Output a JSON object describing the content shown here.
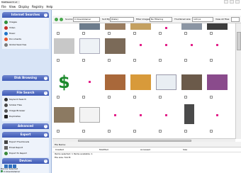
{
  "window": {
    "title": "MultiSearch v1"
  },
  "menu": [
    "File",
    "View",
    "Display",
    "Registry",
    "Help"
  ],
  "toolbar": {
    "source_label": "Source",
    "source_value": "C:\\Users\\Owner",
    "sort_label": "Sort By",
    "sort_value": "[Date]",
    "mode_label": "Filter images",
    "mode_value": "No Filtering",
    "size_label": "Thumbnail size",
    "size_value": "120 px",
    "view_label": "View All Files"
  },
  "sidebar": {
    "sections": [
      {
        "title": "Internet Searches",
        "items": [
          "Images",
          "Video",
          "Music",
          "Documents",
          "Global Searches"
        ]
      },
      {
        "title": "Disk Browsing",
        "items": []
      },
      {
        "title": "File Search",
        "items": [
          "Keyword Search",
          "Similar Files",
          "Image Browser",
          "Duplicates"
        ]
      },
      {
        "title": "Advanced",
        "items": []
      },
      {
        "title": "Export",
        "items": [
          "Export Thumbnails",
          "Email Report",
          "Export To Report"
        ]
      },
      {
        "title": "Devices",
        "items": []
      }
    ],
    "device_label": "Device Selected",
    "device_value": "C:\\Users\\Owner"
  },
  "file_info": {
    "header": "File Name:"
  },
  "columns": [
    "Created",
    "Modified",
    "Accessed",
    "Size"
  ],
  "status_lines": [
    "Items selected: 1   Items available: 1",
    "File size: 512 B"
  ],
  "colors": {
    "accent": "#3d59b6",
    "sidebar_bg": "#d8e4f6",
    "marker": "#e3218a"
  }
}
